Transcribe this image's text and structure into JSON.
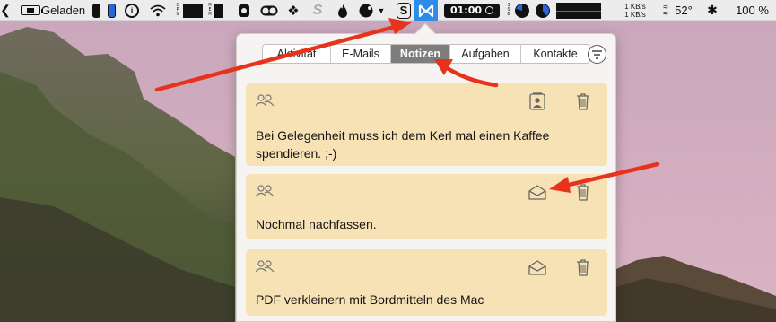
{
  "menubar": {
    "battery_status": "Geladen",
    "app_label": "S",
    "timer": "01:00",
    "cpu_letters": "CPU",
    "mem_letters": "MEM",
    "ssd_letters": "SSD",
    "net_up": "1 KB/s",
    "net_down": "1 KB/s",
    "temperature": "52°",
    "battery_percent": "100 %",
    "icons": [
      "chevron-icon",
      "battery-icon",
      "usb-icon",
      "pill-icon",
      "info-icon",
      "wifi-icon",
      "cpu-icon",
      "mem-icon",
      "rotate-icon",
      "toggle-icon",
      "dropbox-icon",
      "s-icon",
      "flame-icon",
      "theme-icon",
      "dropdown-icon",
      "scrivener-icon",
      "mailbutler-icon",
      "timer-icon",
      "cpu-pie-icon",
      "mem-pie-icon",
      "network-graph-icon",
      "fan-icon",
      "bluetooth-icon"
    ]
  },
  "popover": {
    "tabs": [
      {
        "label": "Aktivität",
        "active": false
      },
      {
        "label": "E-Mails",
        "active": false
      },
      {
        "label": "Notizen",
        "active": true
      },
      {
        "label": "Aufgaben",
        "active": false
      },
      {
        "label": "Kontakte",
        "active": false
      }
    ],
    "notes": [
      {
        "text": "Bei Gelegenheit muss ich dem Kerl mal einen Kaffee spendieren. ;-)",
        "action_icon": "contact-card-icon"
      },
      {
        "text": "Nochmal nachfassen.",
        "action_icon": "envelope-icon"
      },
      {
        "text": "PDF verkleinern mit Bordmitteln des Mac",
        "action_icon": "envelope-icon"
      }
    ]
  },
  "colors": {
    "note_background": "#f7e2b6",
    "active_tab": "#7e7d7b",
    "app_highlight": "#2d8ce8",
    "annotation_red": "#e8331c"
  }
}
